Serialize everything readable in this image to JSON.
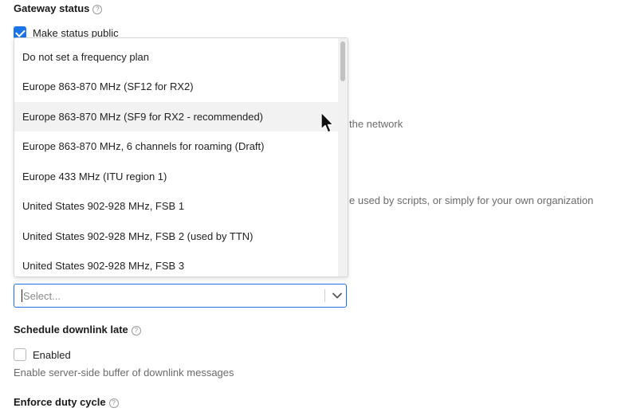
{
  "gateway_status": {
    "label": "Gateway status",
    "help_icon": "question-circle-icon",
    "make_public_label": "Make status public",
    "make_public_checked": true
  },
  "background_fragments": {
    "network_text": "the network",
    "scripts_text": "e used by scripts, or simply for your own organization"
  },
  "frequency_plan": {
    "placeholder": "Select...",
    "chevron_icon": "chevron-down-icon",
    "options": [
      "Do not set a frequency plan",
      "Europe 863-870 MHz (SF12 for RX2)",
      "Europe 863-870 MHz (SF9 for RX2 - recommended)",
      "Europe 863-870 MHz, 6 channels for roaming (Draft)",
      "Europe 433 MHz (ITU region 1)",
      "United States 902-928 MHz, FSB 1",
      "United States 902-928 MHz, FSB 2 (used by TTN)",
      "United States 902-928 MHz, FSB 3"
    ],
    "hovered_index": 2
  },
  "schedule_downlink_late": {
    "label": "Schedule downlink late",
    "help_icon": "question-circle-icon",
    "checkbox_label": "Enabled",
    "checked": false,
    "description": "Enable server-side buffer of downlink messages"
  },
  "enforce_duty_cycle": {
    "label": "Enforce duty cycle",
    "help_icon": "question-circle-icon"
  },
  "colors": {
    "accent": "#1a73e8",
    "hover_row": "#f2f2f2",
    "muted_text": "#6b6b6b"
  }
}
